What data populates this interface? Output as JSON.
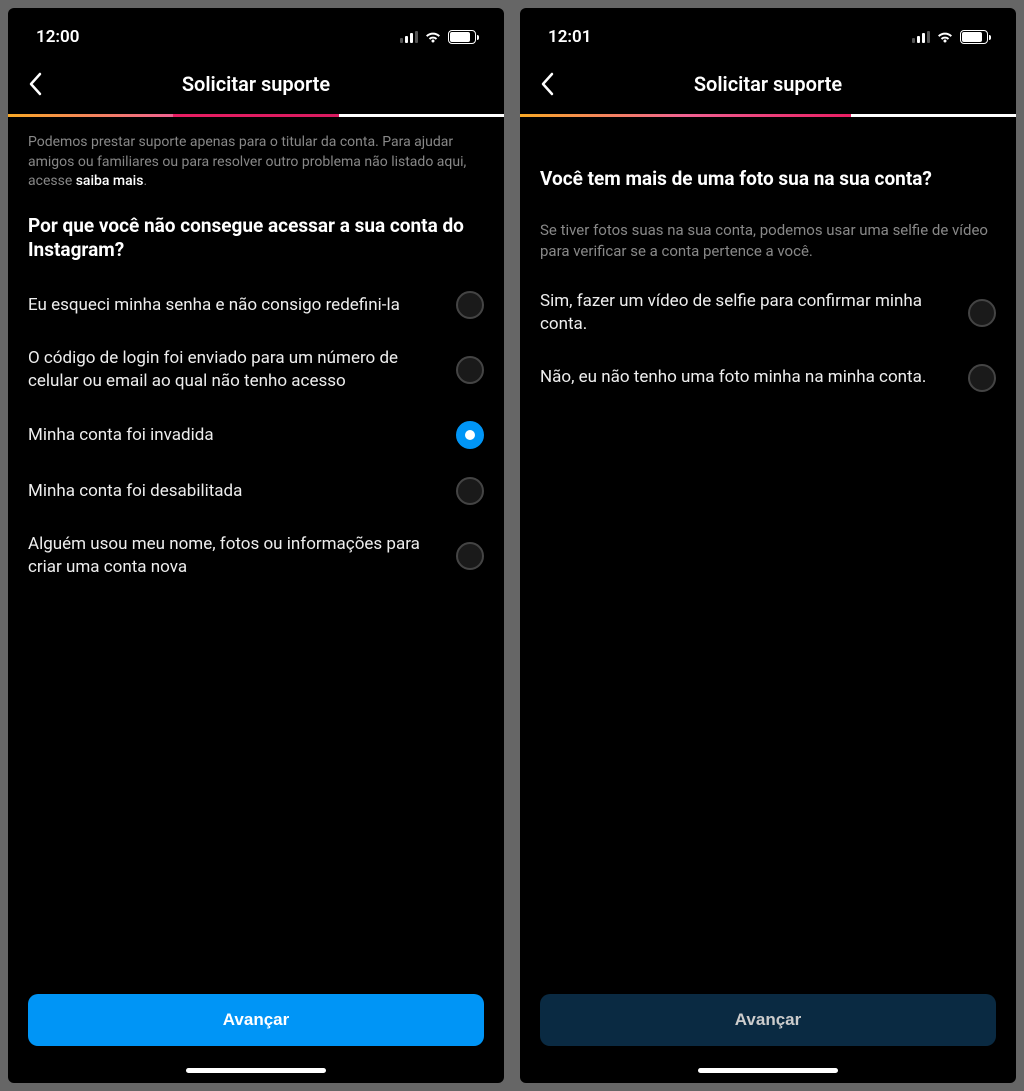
{
  "left": {
    "status": {
      "time": "12:00"
    },
    "nav": {
      "title": "Solicitar suporte"
    },
    "intro": {
      "text_before": "Podemos prestar suporte apenas para o titular da conta. Para ajudar amigos ou familiares ou para resolver outro problema não listado aqui, acesse ",
      "link": "saiba mais",
      "text_after": "."
    },
    "question": "Por que você não consegue acessar a sua conta do Instagram?",
    "options": [
      {
        "label": "Eu esqueci minha senha e não consigo redefini-la",
        "selected": false
      },
      {
        "label": "O código de login foi enviado para um número de celular ou email ao qual não tenho acesso",
        "selected": false
      },
      {
        "label": "Minha conta foi invadida",
        "selected": true
      },
      {
        "label": "Minha conta foi desabilitada",
        "selected": false
      },
      {
        "label": "Alguém usou meu nome, fotos ou informações para criar uma conta nova",
        "selected": false
      }
    ],
    "button": "Avançar"
  },
  "right": {
    "status": {
      "time": "12:01"
    },
    "nav": {
      "title": "Solicitar suporte"
    },
    "question": "Você tem mais de uma foto sua na sua conta?",
    "subtext": "Se tiver fotos suas na sua conta, podemos usar uma selfie de vídeo para verificar se a conta pertence a você.",
    "options": [
      {
        "label": "Sim, fazer um vídeo de selfie para confirmar minha conta.",
        "selected": false
      },
      {
        "label": "Não, eu não tenho uma foto minha na minha conta.",
        "selected": false
      }
    ],
    "button": "Avançar"
  }
}
